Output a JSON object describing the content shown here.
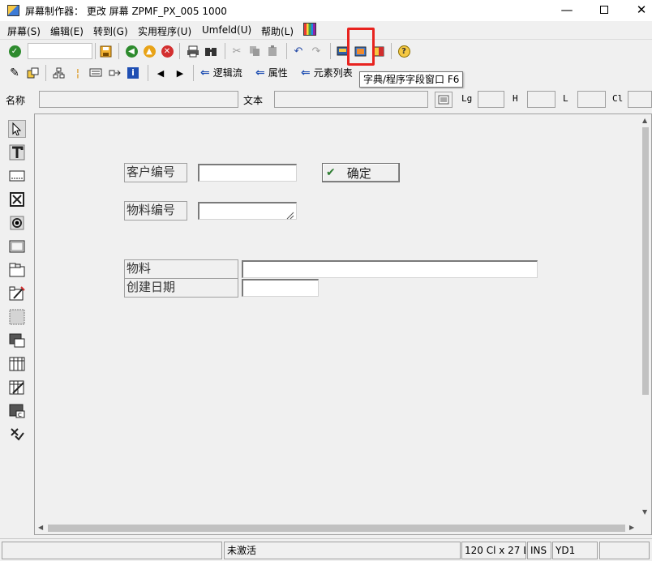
{
  "window": {
    "title": "屏幕制作器： 更改 屏幕 ZPMF_PX_005 1000",
    "minimize": "—",
    "close": "✕"
  },
  "menu": [
    {
      "label": "屏幕(S)"
    },
    {
      "label": "编辑(E)"
    },
    {
      "label": "转到(G)"
    },
    {
      "label": "实用程序(U)"
    },
    {
      "label": "Umfeld(U)"
    },
    {
      "label": "帮助(L)"
    }
  ],
  "toolbar2": {
    "flow_logic": "逻辑流",
    "attributes": "属性",
    "element_list": "元素列表"
  },
  "tooltip": "字典/程序字段窗口 F6",
  "attr_row": {
    "name_label": "名称",
    "name_value": "",
    "text_label": "文本",
    "text_value": "",
    "lg_label": "Lg",
    "h_label": "H",
    "l_label": "L",
    "cl_label": "Cl"
  },
  "screen": {
    "customer_label": "客户编号",
    "customer_value": "",
    "confirm_button": "确定",
    "material_no_label": "物料编号",
    "material_no_value": "",
    "material_label": "物料",
    "material_value": "",
    "created_date_label": "创建日期",
    "created_date_value": ""
  },
  "status": {
    "message": "",
    "state": "未激活",
    "size": "120 Cl x 27 L",
    "mode": "INS",
    "system": "YD1",
    "extra": ""
  },
  "colors": {
    "highlight": "#e8231f",
    "nav_arrow": "#1f4fb3",
    "confirm_check": "#2e7d32"
  }
}
